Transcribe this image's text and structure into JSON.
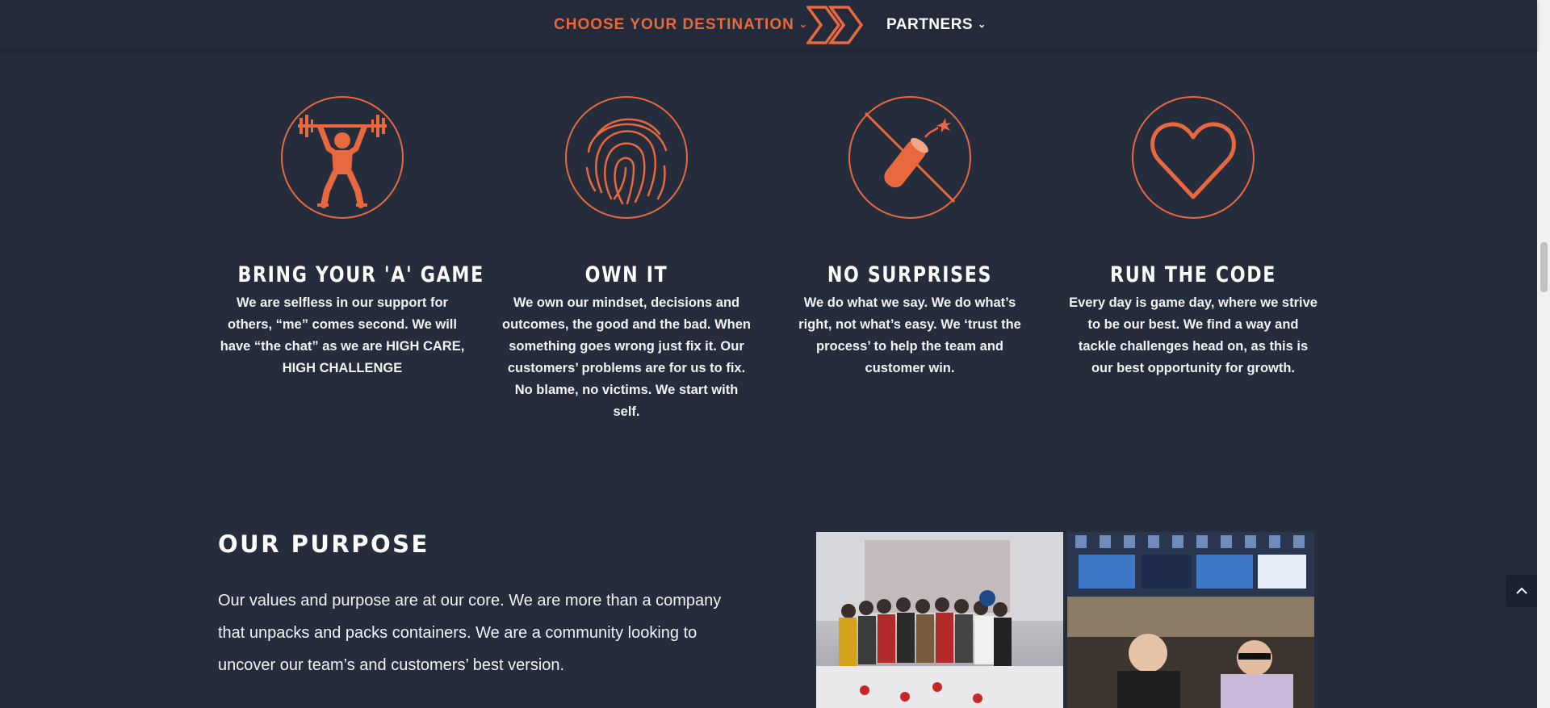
{
  "nav": {
    "destination_label": "CHOOSE YOUR DESTINATION",
    "partners_label": "PARTNERS",
    "chevron": "⌄"
  },
  "colors": {
    "accent": "#e8683f",
    "background": "#252d3d",
    "nav_background": "#232b3a"
  },
  "values": [
    {
      "icon": "weightlifter-icon",
      "title": "BRING YOUR 'A' GAME",
      "text": "We are selfless in our support for others, “me” comes second. We will have “the chat” as we are HIGH CARE, HIGH CHALLENGE"
    },
    {
      "icon": "fingerprint-icon",
      "title": "OWN IT",
      "text": "We own our mindset, decisions and outcomes, the good and the bad. When something goes wrong just fix it. Our customers’ problems are for us to fix. No blame, no victims. We start with self."
    },
    {
      "icon": "no-dynamite-icon",
      "title": "NO SURPRISES",
      "text": "We do what we say. We do what’s right, not what’s easy. We ‘trust the process’ to help the team and customer win."
    },
    {
      "icon": "heart-icon",
      "title": "RUN THE CODE",
      "text": "Every day is game day, where we strive to be our best. We find a way and tackle challenges head on, as this is our best opportunity for growth."
    }
  ],
  "purpose": {
    "title": "OUR PURPOSE",
    "text": "Our values and purpose are at our core. We are more than a company that unpacks and packs containers. We are a community looking to uncover our team’s and customers’ best version."
  },
  "photos": [
    "team-photo-group",
    "team-photo-bar"
  ]
}
